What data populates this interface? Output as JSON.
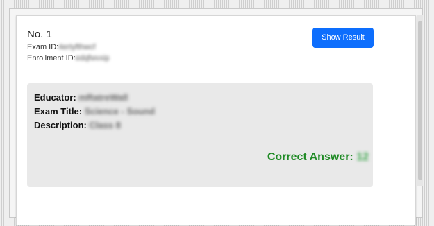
{
  "card": {
    "number": "No. 1",
    "exam_id_label": "Exam ID:",
    "exam_id_value": "4ertyfthwcf",
    "enrollment_id_label": "Enrollment ID:",
    "enrollment_id_value": "edqfwvxip",
    "show_result_label": "Show Result"
  },
  "details": {
    "educator_label": "Educator:",
    "educator_value": "mRatreWall",
    "exam_title_label": "Exam Title:",
    "exam_title_value": "Science - Sound",
    "description_label": "Description:",
    "description_value": "Class 8",
    "correct_answer_label": "Correct Answer:",
    "correct_answer_value": "12"
  },
  "colors": {
    "button": "#0d6efd",
    "answer": "#1e8a24",
    "panel": "#e9e9e9"
  }
}
